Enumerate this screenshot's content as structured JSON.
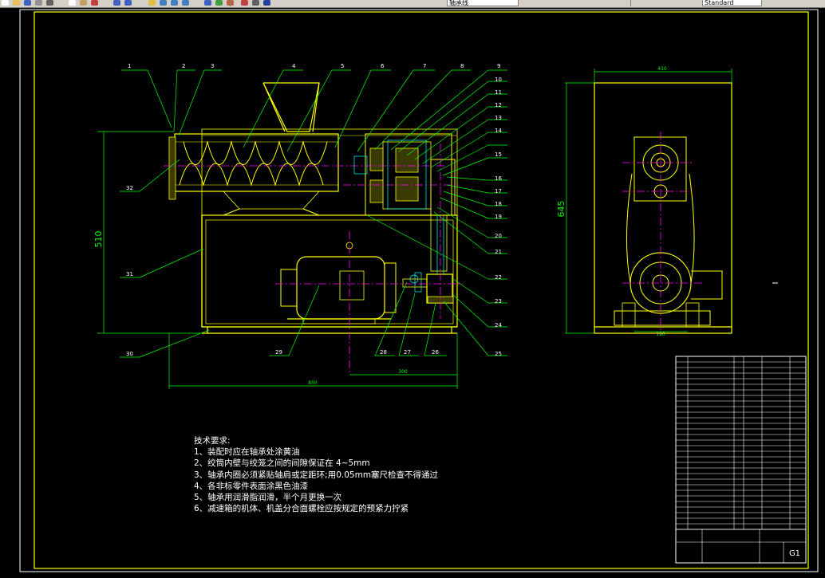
{
  "toolbar": {
    "layer_combo": "轴承线",
    "right_combo": "Standard",
    "buttons": [
      {
        "name": "new-icon",
        "color": "#ffffff"
      },
      {
        "name": "open-icon",
        "color": "#e8c060"
      },
      {
        "name": "save-icon",
        "color": "#4060c0"
      },
      {
        "name": "print-icon",
        "color": "#909090"
      },
      {
        "name": "cut-icon",
        "color": "#606060"
      },
      {
        "name": "copy-icon",
        "color": "#ffffff"
      },
      {
        "name": "paste-icon",
        "color": "#c0a060"
      },
      {
        "name": "match-icon",
        "color": "#c04040"
      },
      {
        "name": "undo-icon",
        "color": "#4060c0"
      },
      {
        "name": "redo-icon",
        "color": "#4060c0"
      },
      {
        "name": "pan-icon",
        "color": "#e0c040"
      },
      {
        "name": "zoom-realtime-icon",
        "color": "#4080c0"
      },
      {
        "name": "zoom-window-icon",
        "color": "#4080c0"
      },
      {
        "name": "zoom-previous-icon",
        "color": "#4080c0"
      },
      {
        "name": "properties-icon",
        "color": "#4060c0"
      },
      {
        "name": "design-center-icon",
        "color": "#40a040"
      },
      {
        "name": "tool-palette-icon",
        "color": "#c06040"
      },
      {
        "name": "markup-icon",
        "color": "#c04040"
      },
      {
        "name": "calculator-icon",
        "color": "#606060"
      },
      {
        "name": "help-icon",
        "color": "#2040a0"
      }
    ]
  },
  "drawing": {
    "dimensions": {
      "height_510": "510",
      "length_850": "850",
      "width_300": "300",
      "height_645": "645",
      "width_410": "410",
      "width_180": "180"
    },
    "part_labels_top": [
      "1",
      "2",
      "3",
      "4",
      "5",
      "6",
      "7",
      "8",
      "9"
    ],
    "part_labels_right": [
      "10",
      "11",
      "12",
      "13",
      "14",
      "15",
      "16",
      "17",
      "18",
      "19",
      "20",
      "21",
      "22",
      "23",
      "24",
      "25"
    ],
    "part_labels_bottom": [
      "26",
      "27",
      "28",
      "29",
      "30"
    ],
    "part_labels_left": [
      "31",
      "32"
    ],
    "notes": [
      "技术要求:",
      "1、装配时应在轴承处涂黄油",
      "2、绞筒内壁与绞笼之间的间隙保证在 4~5mm",
      "3、轴承内圈必须紧贴轴肩或定距环;用0.05mm塞尺检查不得通过",
      "4、各非标零件表面涂黑色油漆",
      "5、轴承用润滑脂润滑，半个月更换一次",
      "6、减速箱的机体、机盖分合面螺栓应按规定的预紧力拧紧"
    ],
    "sheet_code": "G1"
  },
  "colors": {
    "frame": "#ffff00",
    "outline": "#ffff00",
    "leader": "#00ff00",
    "center": "#ff00ff",
    "hidden": "#00ffff",
    "text": "#ffffff"
  }
}
